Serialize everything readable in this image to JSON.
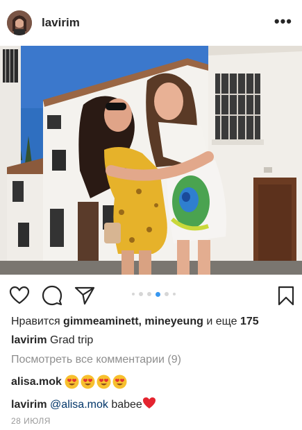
{
  "post": {
    "username": "lavirim",
    "more_icon": "more-options-icon"
  },
  "actions": {
    "like_icon": "heart-icon",
    "comment_icon": "comment-icon",
    "share_icon": "share-icon",
    "save_icon": "bookmark-icon",
    "carousel_total": 6,
    "carousel_active": 4
  },
  "likes": {
    "prefix": "Нравится ",
    "users": "gimmeaminett, mineyeung",
    "middle": " и еще ",
    "count": "175"
  },
  "caption": {
    "username": "lavirim",
    "text": " Grad trip"
  },
  "view_comments": "Посмотреть все комментарии (9)",
  "comments": [
    {
      "username": "alisa.mok",
      "emoji_count": 4
    },
    {
      "username": "lavirim",
      "mention": "@alisa.mok",
      "text": " babee"
    }
  ],
  "date": "28 ИЮЛЯ",
  "colors": {
    "accent": "#3897f0",
    "heart": "#ed4956",
    "mention": "#003569"
  }
}
